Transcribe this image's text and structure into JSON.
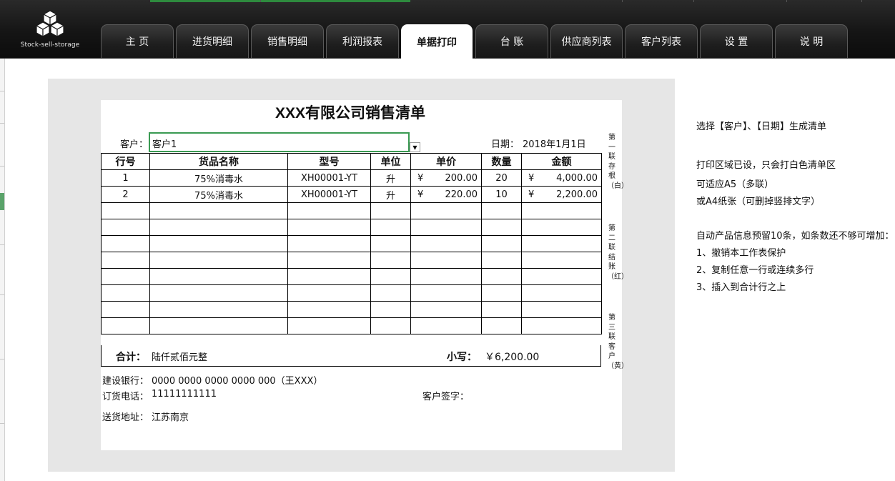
{
  "app": {
    "logo_text": "Stock-sell-storage",
    "accent_color": "#3a9a52"
  },
  "nav": {
    "tabs": [
      {
        "label": "主  页"
      },
      {
        "label": "进货明细"
      },
      {
        "label": "销售明细"
      },
      {
        "label": "利润报表"
      },
      {
        "label": "单据打印",
        "active": true
      },
      {
        "label": "台  账"
      },
      {
        "label": "供应商列表"
      },
      {
        "label": "客户列表"
      },
      {
        "label": "设  置"
      },
      {
        "label": "说  明"
      }
    ]
  },
  "invoice": {
    "title": "XXX有限公司销售清单",
    "customer_label": "客户：",
    "customer_value": "客户1",
    "date_label": "日期：",
    "date_value": "2018年1月1日",
    "headers": [
      "行号",
      "货品名称",
      "型号",
      "单位",
      "单价",
      "数量",
      "金额"
    ],
    "currency_symbol": "¥",
    "rows": [
      {
        "no": "1",
        "name": "75%消毒水",
        "model": "XH00001-YT",
        "unit": "升",
        "price": "200.00",
        "qty": "20",
        "amount": "4,000.00"
      },
      {
        "no": "2",
        "name": "75%消毒水",
        "model": "XH00001-YT",
        "unit": "升",
        "price": "220.00",
        "qty": "10",
        "amount": "2,200.00"
      }
    ],
    "empty_rows": 8,
    "total_label": "合计：",
    "total_words": "陆仟贰佰元整",
    "small_label": "小写：",
    "small_value": "￥6,200.00",
    "bank_label": "建设银行：",
    "bank_value": "0000 0000 0000 0000 000（王XXX）",
    "phone_label": "订货电话：",
    "phone_value": "11111111111",
    "sign_label": "客户签字：",
    "address_label": "送货地址：",
    "address_value": "江苏南京",
    "side_copies": [
      "第一联存根（白）",
      "第二联结账（红）",
      "第三联客户（黄）"
    ]
  },
  "notes": [
    "选择【客户】、【日期】生成清单",
    "打印区域已设，只会打白色清单区",
    "可适应A5（多联）",
    "或A4纸张（可删掉竖排文字）",
    "自动产品信息预留10条，如条数还不够可增加：",
    "1、撤销本工作表保护",
    "2、复制任意一行或连续多行",
    "3、插入到合计行之上"
  ]
}
